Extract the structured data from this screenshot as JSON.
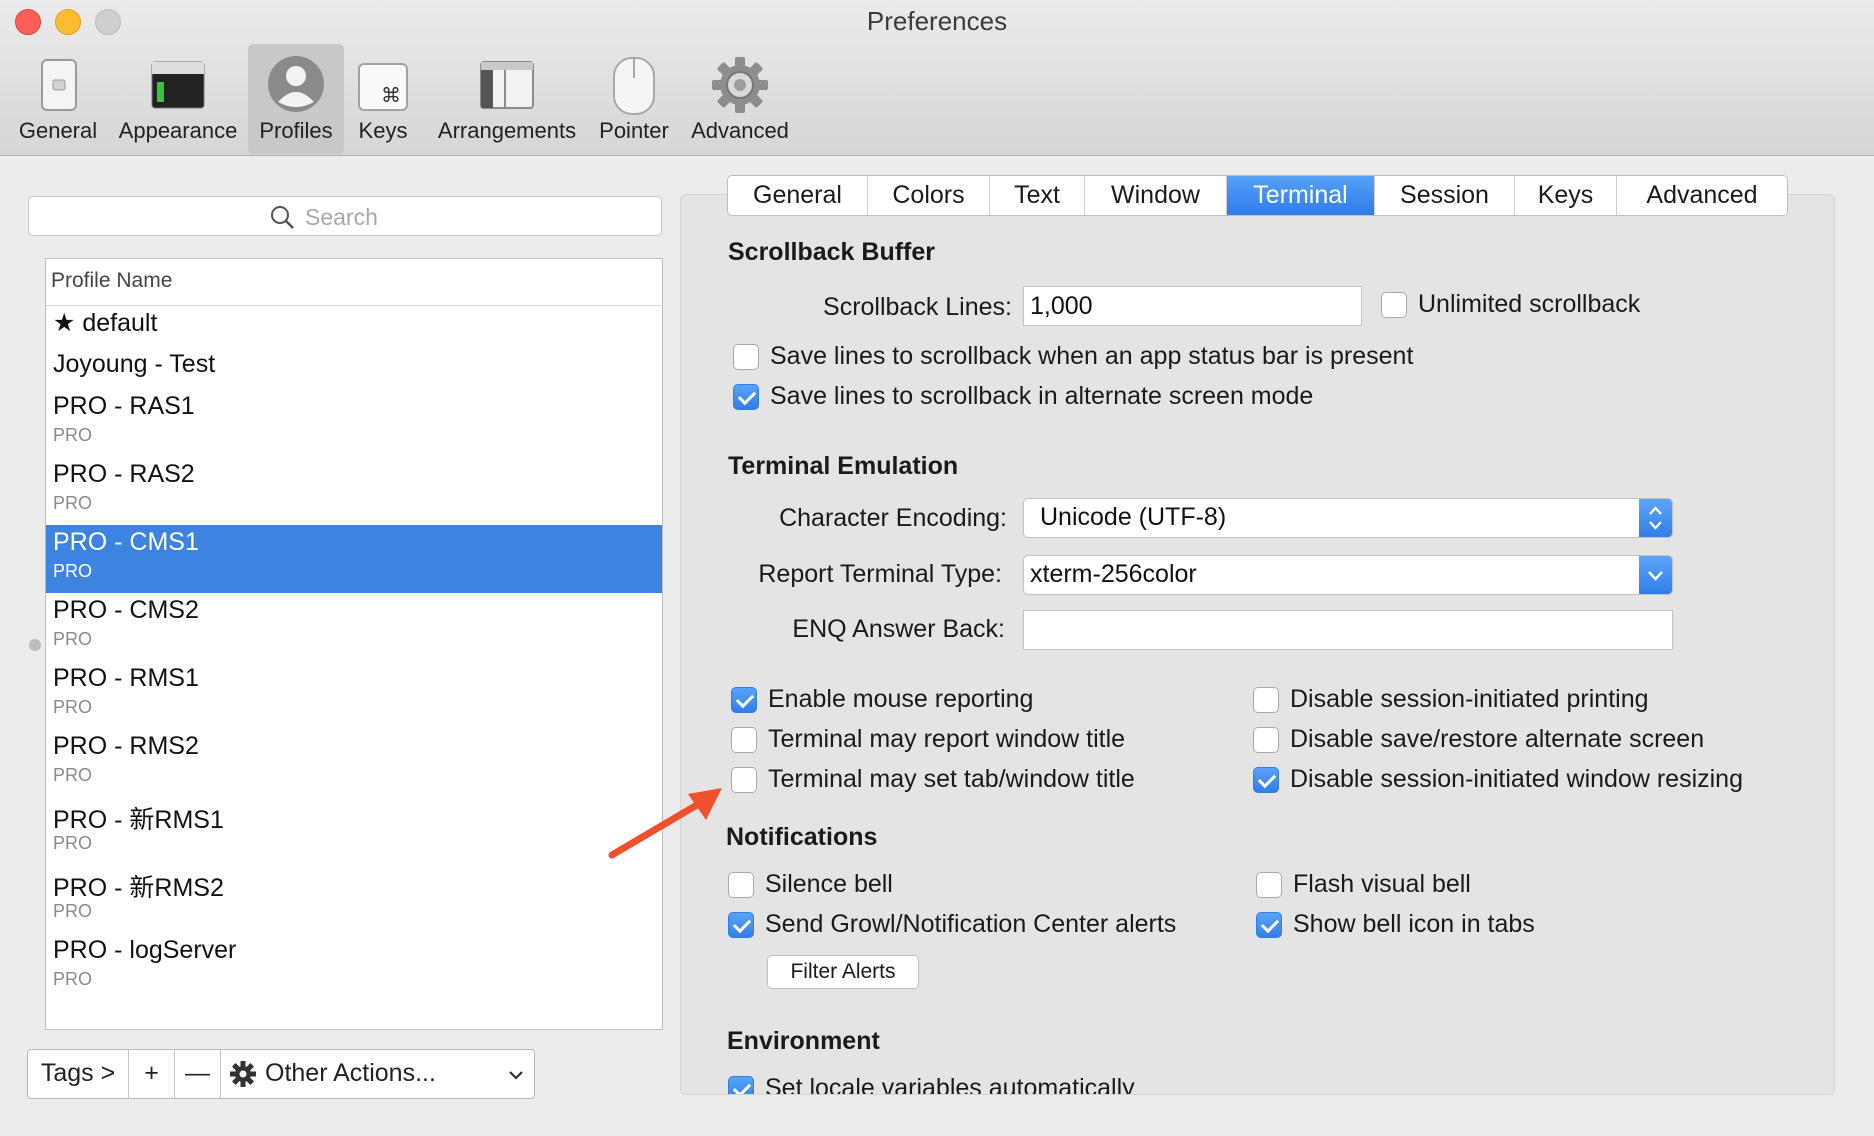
{
  "window": {
    "title": "Preferences"
  },
  "toolbar": {
    "items": [
      {
        "label": "General",
        "icon": "general-switch-icon"
      },
      {
        "label": "Appearance",
        "icon": "appearance-window-icon"
      },
      {
        "label": "Profiles",
        "icon": "profile-avatar-icon",
        "selected": true
      },
      {
        "label": "Keys",
        "icon": "command-key-icon"
      },
      {
        "label": "Arrangements",
        "icon": "arrangements-windows-icon"
      },
      {
        "label": "Pointer",
        "icon": "mouse-icon"
      },
      {
        "label": "Advanced",
        "icon": "gear-icon"
      }
    ]
  },
  "profiles": {
    "search_placeholder": "Search",
    "column_header": "Profile Name",
    "items": [
      {
        "name": "★ default",
        "tag": ""
      },
      {
        "name": "Joyoung - Test",
        "tag": ""
      },
      {
        "name": "PRO - RAS1",
        "tag": "PRO"
      },
      {
        "name": "PRO - RAS2",
        "tag": "PRO"
      },
      {
        "name": "PRO - CMS1",
        "tag": "PRO",
        "selected": true
      },
      {
        "name": "PRO - CMS2",
        "tag": "PRO"
      },
      {
        "name": "PRO - RMS1",
        "tag": "PRO"
      },
      {
        "name": "PRO - RMS2",
        "tag": "PRO"
      },
      {
        "name": "PRO - 新RMS1",
        "tag": "PRO"
      },
      {
        "name": "PRO - 新RMS2",
        "tag": "PRO"
      },
      {
        "name": "PRO - logServer",
        "tag": "PRO"
      }
    ],
    "bottom": {
      "tags": "Tags >",
      "add": "+",
      "remove": "—",
      "other_actions": "Other Actions..."
    }
  },
  "tabs": [
    "General",
    "Colors",
    "Text",
    "Window",
    "Terminal",
    "Session",
    "Keys",
    "Advanced"
  ],
  "active_tab": "Terminal",
  "scrollback": {
    "title": "Scrollback Buffer",
    "lines_label": "Scrollback Lines:",
    "lines_value": "1,000",
    "unlimited": {
      "label": "Unlimited scrollback",
      "checked": false
    },
    "save_status_bar": {
      "label": "Save lines to scrollback when an app status bar is present",
      "checked": false
    },
    "save_alternate": {
      "label": "Save lines to scrollback in alternate screen mode",
      "checked": true
    }
  },
  "emulation": {
    "title": "Terminal Emulation",
    "encoding_label": "Character Encoding:",
    "encoding_value": "Unicode (UTF-8)",
    "type_label": "Report Terminal Type:",
    "type_value": "xterm-256color",
    "enq_label": "ENQ Answer Back:",
    "enq_value": "",
    "options_left": [
      {
        "label": "Enable mouse reporting",
        "checked": true
      },
      {
        "label": "Terminal may report window title",
        "checked": false
      },
      {
        "label": "Terminal may set tab/window title",
        "checked": false
      }
    ],
    "options_right": [
      {
        "label": "Disable session-initiated printing",
        "checked": false
      },
      {
        "label": "Disable save/restore alternate screen",
        "checked": false
      },
      {
        "label": "Disable session-initiated window resizing",
        "checked": true
      }
    ]
  },
  "notifications": {
    "title": "Notifications",
    "silence_bell": {
      "label": "Silence bell",
      "checked": false
    },
    "flash_bell": {
      "label": "Flash visual bell",
      "checked": false
    },
    "growl": {
      "label": "Send Growl/Notification Center alerts",
      "checked": true
    },
    "bell_icon": {
      "label": "Show bell icon in tabs",
      "checked": true
    },
    "filter_button": "Filter Alerts"
  },
  "environment": {
    "title": "Environment",
    "locale": {
      "label": "Set locale variables automatically",
      "checked": true
    }
  },
  "colors": {
    "accent": "#3d83e0",
    "annotation_arrow": "#f0502a"
  }
}
